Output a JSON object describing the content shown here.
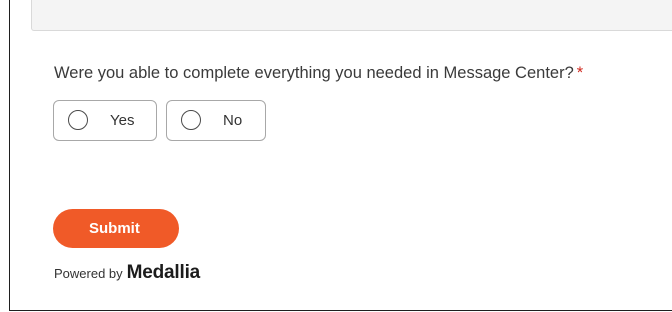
{
  "survey": {
    "question": "Were you able to complete everything you needed in Message Center?",
    "required_marker": "*",
    "choices": [
      {
        "label": "Yes",
        "selected": false
      },
      {
        "label": "No",
        "selected": false
      }
    ],
    "submit_label": "Submit",
    "accent_color": "#f05a28"
  },
  "footer": {
    "powered_by": "Powered by",
    "brand": "Medallia"
  }
}
